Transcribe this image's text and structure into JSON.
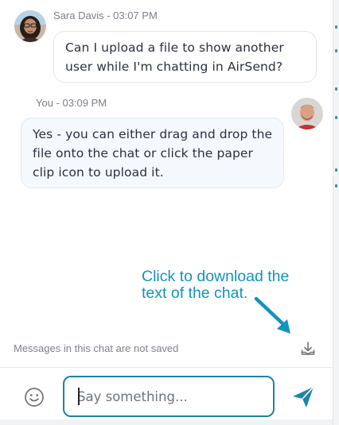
{
  "messages": [
    {
      "sender": "Sara Davis",
      "time": "03:07 PM",
      "meta": "Sara Davis - 03:07 PM",
      "lines": [
        "Can I upload a file to show another",
        "user while I'm chatting in AirSend?"
      ]
    },
    {
      "sender": "You",
      "time": "03:09 PM",
      "meta": "You - 03:09 PM",
      "lines": [
        "Yes - you can either drag and drop the",
        "file onto the chat or click the paper",
        "clip icon to upload it."
      ]
    }
  ],
  "annotation": {
    "lines": [
      "Click to download the",
      "text of the chat."
    ],
    "color": "#1393c0"
  },
  "footer": {
    "notice": "Messages in this chat are not saved",
    "download_icon": "download-icon"
  },
  "composer": {
    "placeholder": "Say something...",
    "value": "",
    "emoji_icon": "smiley-icon",
    "send_icon": "send-icon",
    "accent": "#21839e"
  }
}
